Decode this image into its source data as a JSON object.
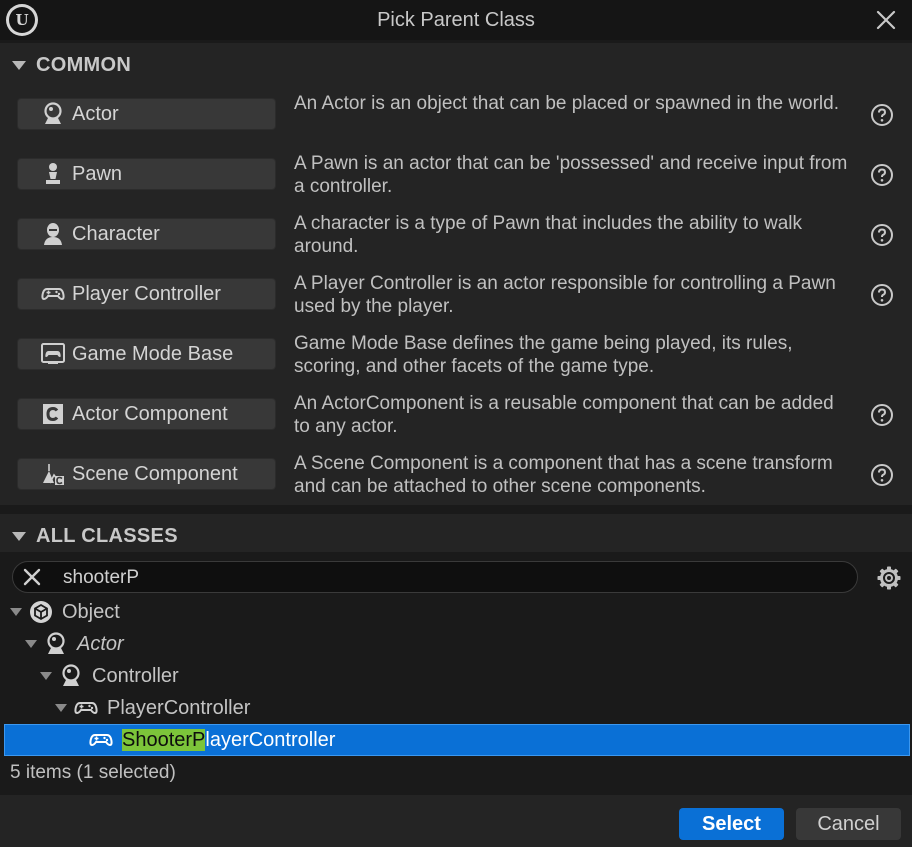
{
  "window": {
    "title": "Pick Parent Class"
  },
  "common": {
    "header": "COMMON",
    "classes": [
      {
        "label": "Actor",
        "icon": "actor-icon",
        "description": "An Actor is an object that can be placed or spawned in the world.",
        "has_help": true
      },
      {
        "label": "Pawn",
        "icon": "pawn-icon",
        "description": "A Pawn is an actor that can be 'possessed' and receive input from a controller.",
        "has_help": true
      },
      {
        "label": "Character",
        "icon": "character-icon",
        "description": "A character is a type of Pawn that includes the ability to walk around.",
        "has_help": true
      },
      {
        "label": "Player Controller",
        "icon": "gamepad-icon",
        "description": "A Player Controller is an actor responsible for controlling a Pawn used by the player.",
        "has_help": true
      },
      {
        "label": "Game Mode Base",
        "icon": "game-mode-icon",
        "description": "Game Mode Base defines the game being played, its rules, scoring, and other facets of the game type.",
        "has_help": false
      },
      {
        "label": "Actor Component",
        "icon": "actor-component-icon",
        "description": "An ActorComponent is a reusable component that can be added to any actor.",
        "has_help": true
      },
      {
        "label": "Scene Component",
        "icon": "scene-component-icon",
        "description": "A Scene Component is a component that has a scene transform and can be attached to other scene components.",
        "has_help": true
      }
    ]
  },
  "all_classes": {
    "header": "ALL CLASSES",
    "search": {
      "value": "shooterP"
    },
    "tree": [
      {
        "label": "Object",
        "icon": "object-icon",
        "italic": false,
        "expanded": true,
        "selected": false
      },
      {
        "label": "Actor",
        "icon": "actor-icon",
        "italic": true,
        "expanded": true,
        "selected": false
      },
      {
        "label": "Controller",
        "icon": "actor-icon",
        "italic": false,
        "expanded": true,
        "selected": false
      },
      {
        "label": "PlayerController",
        "icon": "gamepad-icon",
        "italic": false,
        "expanded": true,
        "selected": false
      },
      {
        "label_match": "ShooterP",
        "label_rest": "layerController",
        "icon": "gamepad-icon",
        "italic": false,
        "expanded": false,
        "selected": true
      }
    ],
    "status": "5 items (1 selected)"
  },
  "footer": {
    "select_label": "Select",
    "cancel_label": "Cancel"
  },
  "colors": {
    "accent": "#0a70d6",
    "highlight": "#7cc43a",
    "panel": "#242424",
    "background": "#1a1a1a"
  }
}
